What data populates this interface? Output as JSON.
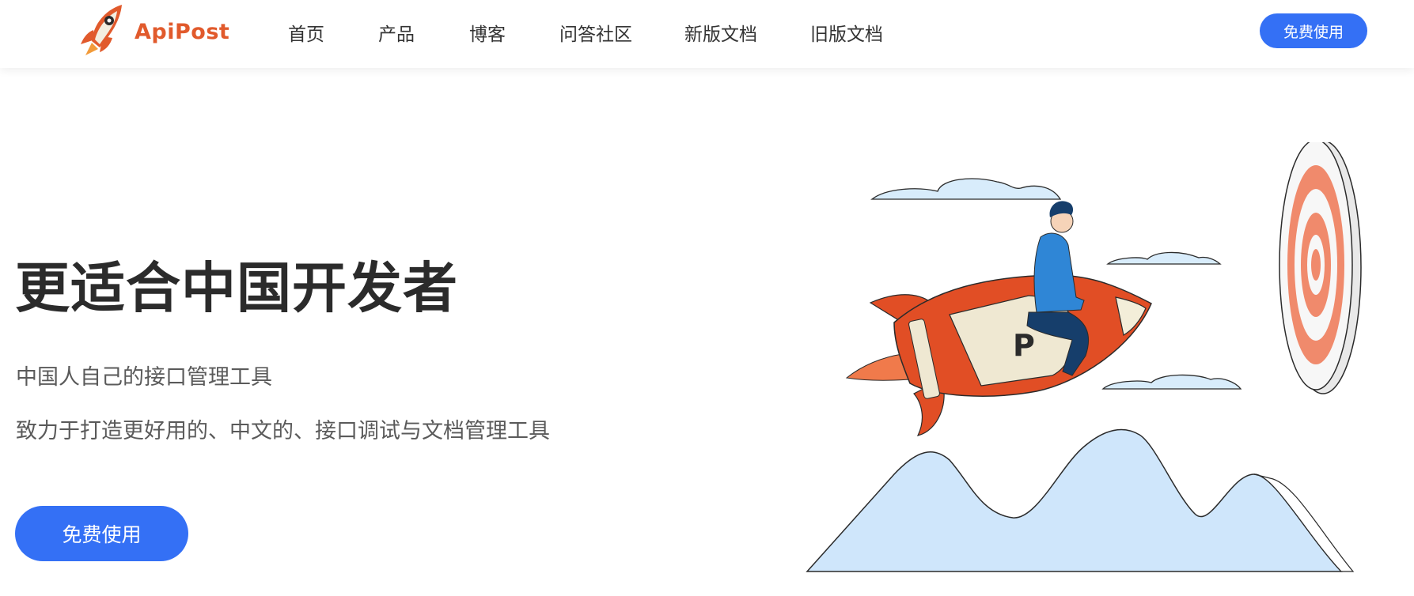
{
  "header": {
    "logo_text": "ApiPost",
    "nav": [
      {
        "label": "首页",
        "name": "nav-home"
      },
      {
        "label": "产品",
        "name": "nav-product"
      },
      {
        "label": "博客",
        "name": "nav-blog"
      },
      {
        "label": "问答社区",
        "name": "nav-qa"
      },
      {
        "label": "新版文档",
        "name": "nav-new-docs"
      },
      {
        "label": "旧版文档",
        "name": "nav-old-docs"
      }
    ],
    "cta_label": "免费使用"
  },
  "hero": {
    "title": "更适合中国开发者",
    "subtitle1": "中国人自己的接口管理工具",
    "subtitle2": "致力于打造更好用的、中文的、接口调试与文档管理工具",
    "cta_label": "免费使用"
  },
  "colors": {
    "brand": "#e15a2c",
    "accent_blue": "#3470f5",
    "mountain": "#cfe6fb",
    "target_ring": "#f08a6c"
  },
  "icons": {
    "logo": "rocket-logo-icon",
    "illustration": "rocket-rider-illustration"
  }
}
